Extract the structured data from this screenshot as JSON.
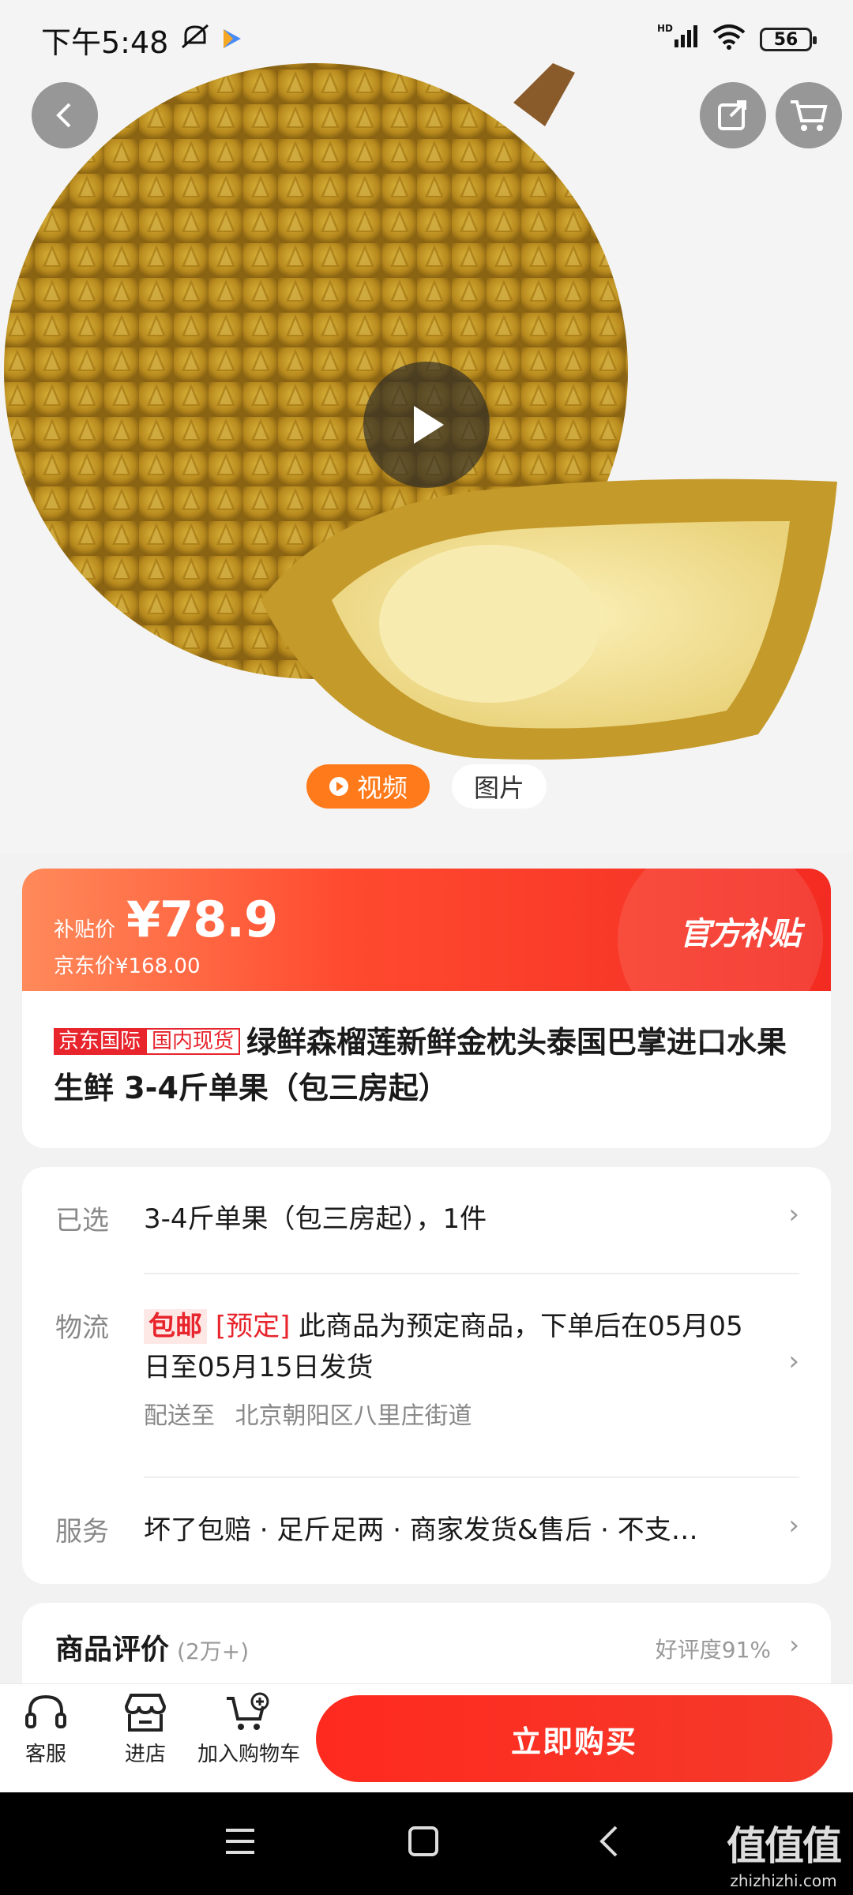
{
  "status_bar": {
    "time": "下午5:48",
    "network": "HD",
    "battery": "56"
  },
  "media": {
    "tab_video": "视频",
    "tab_image": "图片"
  },
  "price": {
    "label": "补贴价",
    "value": "¥78.9",
    "original": "京东价¥168.00",
    "subsidy_badge": "官方补贴"
  },
  "product": {
    "tag_jd_intl": "京东国际",
    "tag_stock": "国内现货",
    "title": "绿鲜森榴莲新鲜金枕头泰国巴掌进口水果生鲜 3-4斤单果（包三房起）"
  },
  "selection": {
    "label": "已选",
    "value": "3-4斤单果（包三房起），1件"
  },
  "logistics": {
    "label": "物流",
    "free_shipping": "包邮",
    "preorder": "[预定]",
    "text": "此商品为预定商品，下单后在05月05日至05月15日发货",
    "deliver_to_label": "配送至",
    "deliver_to": "北京朝阳区八里庄街道"
  },
  "service": {
    "label": "服务",
    "value": "坏了包赔 · 足斤足两 · 商家发货&售后 · 不支…"
  },
  "reviews": {
    "title": "商品评价",
    "count": "(2万+)",
    "rating": "好评度91%"
  },
  "actions": {
    "customer_service": "客服",
    "store": "进店",
    "add_cart": "加入购物车",
    "buy_now": "立即购买"
  },
  "watermark": {
    "big": "值值值",
    "small": "zhizhizhi.com"
  },
  "colors": {
    "accent": "#f32b22",
    "orange": "#ff7a1a"
  }
}
